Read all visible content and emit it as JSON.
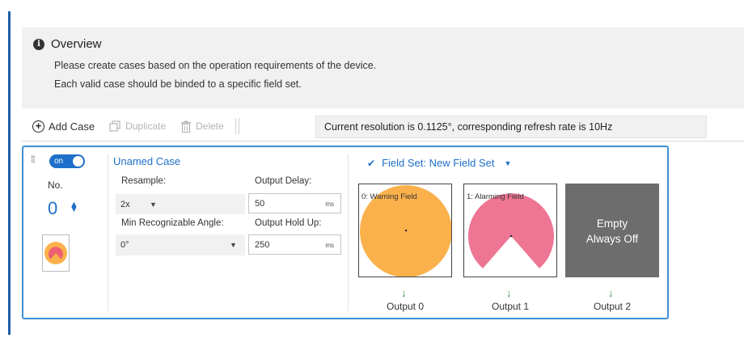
{
  "overview": {
    "title": "Overview",
    "line1": "Please create cases based on the operation requirements of the device.",
    "line2": "Each valid case should be binded to a specific field set."
  },
  "toolbar": {
    "add_case": "Add Case",
    "duplicate": "Duplicate",
    "delete": "Delete",
    "resolution_text": "Current resolution is 0.1125°, corresponding refresh rate is 10Hz"
  },
  "case": {
    "toggle_label": "on",
    "enabled": true,
    "no_label": "No.",
    "no_value": "0",
    "name": "Unamed Case",
    "resample_label": "Resample:",
    "resample_value": "2x",
    "output_delay_label": "Output Delay:",
    "output_delay_value": "50",
    "output_delay_unit": "ms",
    "min_angle_label": "Min Recognizable Angle:",
    "min_angle_value": "0°",
    "output_hold_label": "Output Hold Up:",
    "output_hold_value": "250",
    "output_hold_unit": "ms",
    "field_set_label": "Field Set: New Field Set",
    "fields": [
      {
        "label": "0: Warning Field",
        "output": "Output 0",
        "color": "#fbb14b"
      },
      {
        "label": "1: Alarming Field",
        "output": "Output 1",
        "color": "#ee7594"
      },
      {
        "label_line1": "Empty",
        "label_line2": "Always Off",
        "output": "Output 2",
        "color": "#6d6d6d"
      }
    ]
  },
  "colors": {
    "accent": "#1d6fc9",
    "card_border": "#3f8fd4",
    "arrow": "#2f8a3c"
  }
}
